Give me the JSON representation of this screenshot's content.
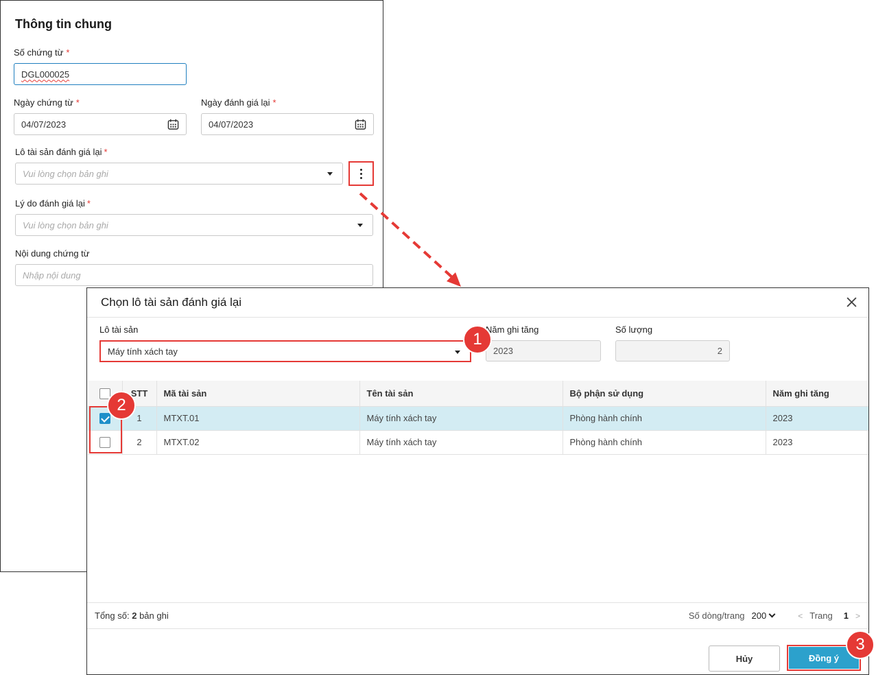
{
  "form": {
    "title": "Thông tin chung",
    "voucher_no_label": "Số chứng từ",
    "voucher_no_value": "DGL000025",
    "voucher_date_label": "Ngày chứng từ",
    "voucher_date_value": "04/07/2023",
    "revaluation_date_label": "Ngày đánh giá lại",
    "revaluation_date_value": "04/07/2023",
    "asset_batch_label": "Lô tài sản đánh giá lại",
    "asset_batch_placeholder": "Vui lòng chọn bản ghi",
    "reason_label": "Lý do đánh giá lại",
    "reason_placeholder": "Vui lòng chọn bản ghi",
    "content_label": "Nội dung chứng từ",
    "content_placeholder": "Nhập nội dung",
    "required_mark": "*"
  },
  "dialog": {
    "title": "Chọn lô tài sản đánh giá lại",
    "batch_label": "Lô tài sản",
    "batch_value": "Máy tính xách tay",
    "year_label": "Năm ghi tăng",
    "year_value": "2023",
    "qty_label": "Số lượng",
    "qty_value": "2",
    "columns": [
      "STT",
      "Mã tài sản",
      "Tên tài sản",
      "Bộ phận sử dụng",
      "Năm ghi tăng"
    ],
    "rows": [
      {
        "stt": "1",
        "code": "MTXT.01",
        "name": "Máy tính xách tay",
        "dept": "Phòng hành chính",
        "year": "2023",
        "checked": true
      },
      {
        "stt": "2",
        "code": "MTXT.02",
        "name": "Máy tính xách tay",
        "dept": "Phòng hành chính",
        "year": "2023",
        "checked": false
      }
    ],
    "total_prefix": "Tổng số:",
    "total_count": "2",
    "total_suffix": "bản ghi",
    "rows_per_page_label": "Số dòng/trang",
    "rows_per_page_value": "200",
    "page_label": "Trang",
    "page_value": "1",
    "prev_symbol": "<",
    "next_symbol": ">",
    "cancel_label": "Hủy",
    "ok_label": "Đồng ý"
  },
  "badges": [
    "1",
    "2",
    "3"
  ],
  "colors": {
    "highlight": "#e53935",
    "primary": "#2ca1cc",
    "selected_row": "#d3ecf3"
  }
}
